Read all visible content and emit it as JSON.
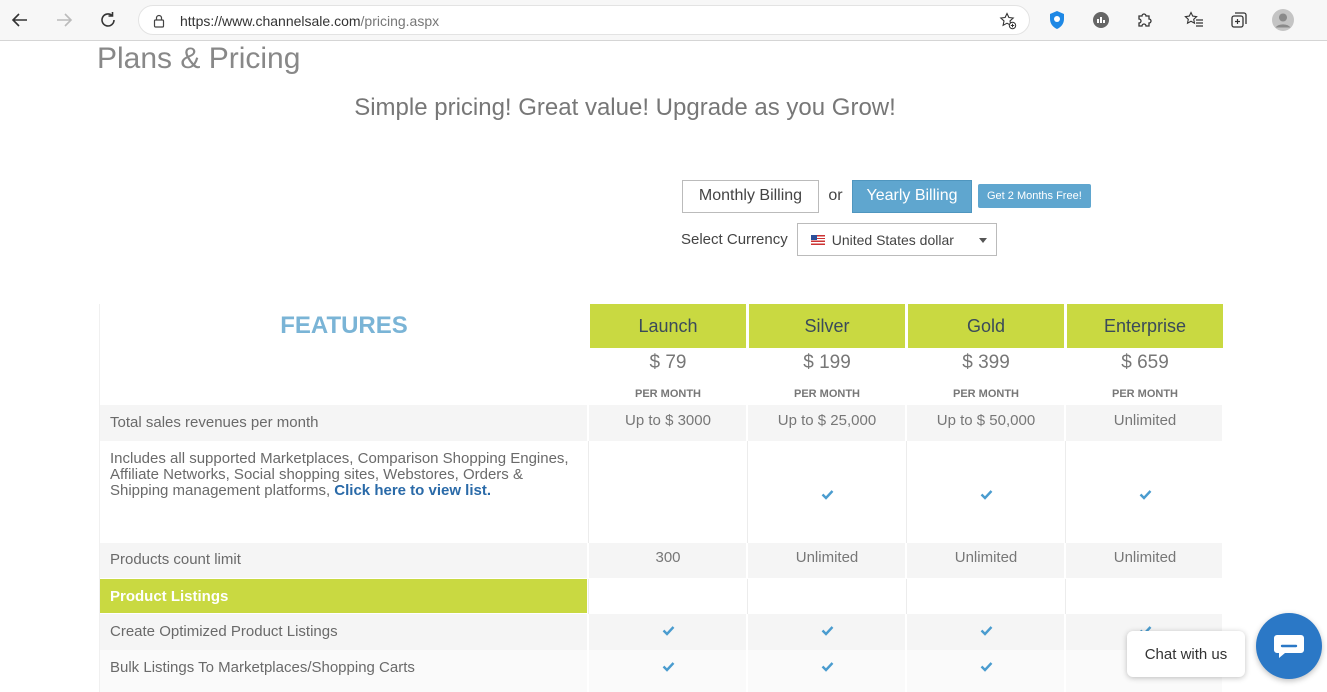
{
  "browser": {
    "url_host": "https://www.channelsale.com",
    "url_path": "/pricing.aspx"
  },
  "page": {
    "title": "Plans & Pricing",
    "tagline": "Simple pricing! Great value! Upgrade as you Grow!"
  },
  "billing": {
    "monthly_label": "Monthly Billing",
    "or_label": "or",
    "yearly_label": "Yearly Billing",
    "promo_label": "Get 2 Months Free!",
    "currency_label": "Select Currency",
    "currency_selected": "United States dollar"
  },
  "table": {
    "features_heading": "FEATURES",
    "plans": [
      {
        "name": "Launch",
        "price": "$ 79",
        "per": "PER MONTH"
      },
      {
        "name": "Silver",
        "price": "$ 199",
        "per": "PER MONTH"
      },
      {
        "name": "Gold",
        "price": "$ 399",
        "per": "PER MONTH"
      },
      {
        "name": "Enterprise",
        "price": "$ 659",
        "per": "PER MONTH"
      }
    ],
    "rows": {
      "revenue": {
        "label": "Total sales revenues per month",
        "values": [
          "Up to $ 3000",
          "Up to $ 25,000",
          "Up to $ 50,000",
          "Unlimited"
        ]
      },
      "marketplaces": {
        "label": "Includes all supported Marketplaces, Comparison Shopping Engines, Affiliate Networks, Social shopping sites, Webstores, Orders & Shipping management platforms,",
        "link": "Click here to view list."
      },
      "products": {
        "label": "Products count limit",
        "values": [
          "300",
          "Unlimited",
          "Unlimited",
          "Unlimited"
        ]
      },
      "section": "Product Listings",
      "optimized": {
        "label": "Create Optimized Product Listings"
      },
      "bulk": {
        "label": "Bulk Listings To Marketplaces/Shopping Carts"
      }
    }
  },
  "chat": {
    "label": "Chat with us"
  },
  "colors": {
    "accent_green": "#c9d941",
    "accent_blue": "#5fa6cf",
    "chat_blue": "#2b78c6"
  }
}
